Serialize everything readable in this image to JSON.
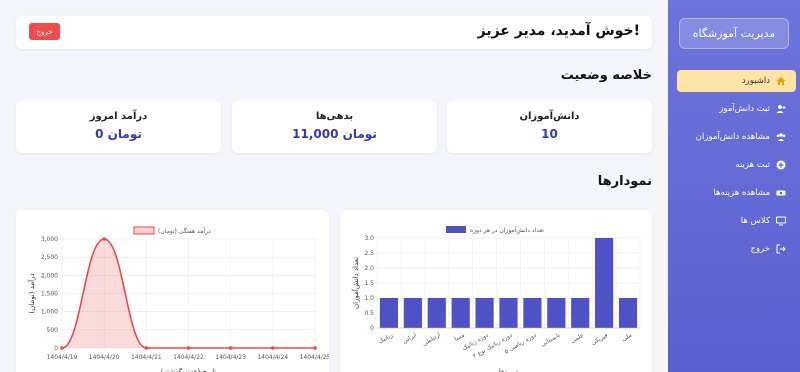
{
  "sidebar": {
    "brand": "مدیریت آموزشگاه",
    "items": [
      {
        "label": "داشبورد",
        "icon": "home-icon",
        "active": true
      },
      {
        "label": "ثبت دانش‌آموز",
        "icon": "user-plus-icon",
        "active": false
      },
      {
        "label": "مشاهده دانش‌آموزان",
        "icon": "users-icon",
        "active": false
      },
      {
        "label": "ثبت هزینه",
        "icon": "plus-circle-icon",
        "active": false
      },
      {
        "label": "مشاهده هزینه‌ها",
        "icon": "money-icon",
        "active": false
      },
      {
        "label": "کلاس ها",
        "icon": "chalkboard-icon",
        "active": false
      },
      {
        "label": "خروج",
        "icon": "sign-out-icon",
        "active": false
      }
    ]
  },
  "header": {
    "welcome": "خوش آمدید، مدیر عزیز!",
    "logout": "خروج"
  },
  "summary": {
    "title": "خلاصه وضعیت",
    "cards": [
      {
        "label": "دانش‌آموزان",
        "value": "10"
      },
      {
        "label": "بدهی‌ها",
        "value": "11,000 تومان"
      },
      {
        "label": "درآمد امروز",
        "value": "0 تومان"
      }
    ]
  },
  "charts_title": "نمودارها",
  "colors": {
    "accent": "#5a5fcf",
    "bar": "#4e52c4",
    "line": "#e84a4a",
    "danger": "#ee4d4d",
    "active": "#fde3a6"
  },
  "chart_data": [
    {
      "type": "bar",
      "legend": "تعداد دانش‌آموزان در هر دوره",
      "ylabel": "تعداد دانش‌آموزان",
      "xlabel": "دوره‌ها",
      "ylim": [
        0,
        3
      ],
      "yticks": [
        "0",
        "0.5",
        "1.0",
        "1.5",
        "2.0",
        "2.5",
        "3.0"
      ],
      "categories": [
        "رباتیک",
        "ایرانی",
        "ارتباطی",
        "مسا",
        "دوره رباتیک",
        "دوره رباتیک نوع ۲",
        "دوره ریاضی ۵",
        "تابستانی",
        "علمی",
        "فیزیکی",
        "ملی"
      ],
      "values": [
        1,
        1,
        1,
        1,
        1,
        1,
        1,
        1,
        1,
        3,
        1
      ]
    },
    {
      "type": "line",
      "legend": "درآمد هفتگی (تومان)",
      "ylabel": "درآمد (تومان)",
      "xlabel": "تاریخ (هفته گذشته)",
      "ylim": [
        0,
        3000
      ],
      "yticks": [
        "0",
        "500",
        "1,000",
        "1,500",
        "2,000",
        "2,500",
        "3,000"
      ],
      "x": [
        "1404/4/19",
        "1404/4/20",
        "1404/4/21",
        "1404/4/22",
        "1404/4/23",
        "1404/4/24",
        "1404/4/25"
      ],
      "values": [
        0,
        3000,
        0,
        0,
        0,
        0,
        0
      ]
    }
  ]
}
